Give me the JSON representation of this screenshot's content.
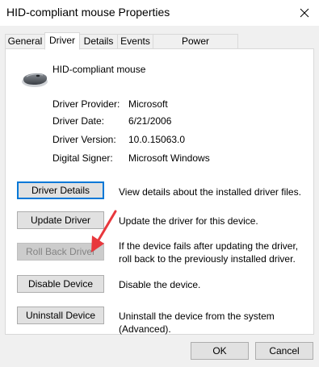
{
  "window": {
    "title": "HID-compliant mouse Properties"
  },
  "tabs": [
    {
      "label": "General"
    },
    {
      "label": "Driver"
    },
    {
      "label": "Details"
    },
    {
      "label": "Events"
    },
    {
      "label": "Power Management"
    }
  ],
  "device": {
    "name": "HID-compliant mouse",
    "icon": "mouse-icon"
  },
  "driver_info": {
    "provider_label": "Driver Provider:",
    "provider_value": "Microsoft",
    "date_label": "Driver Date:",
    "date_value": "6/21/2006",
    "version_label": "Driver Version:",
    "version_value": "10.0.15063.0",
    "signer_label": "Digital Signer:",
    "signer_value": "Microsoft Windows"
  },
  "actions": {
    "details_label": "Driver Details",
    "details_desc": "View details about the installed driver files.",
    "update_label": "Update Driver",
    "update_desc": "Update the driver for this device.",
    "rollback_label": "Roll Back Driver",
    "rollback_desc": "If the device fails after updating the driver, roll back to the previously installed driver.",
    "disable_label": "Disable Device",
    "disable_desc": "Disable the device.",
    "uninstall_label": "Uninstall Device",
    "uninstall_desc": "Uninstall the device from the system (Advanced)."
  },
  "footer": {
    "ok_label": "OK",
    "cancel_label": "Cancel"
  },
  "colors": {
    "focus_border": "#0078d7",
    "arrow": "#e8383d"
  }
}
